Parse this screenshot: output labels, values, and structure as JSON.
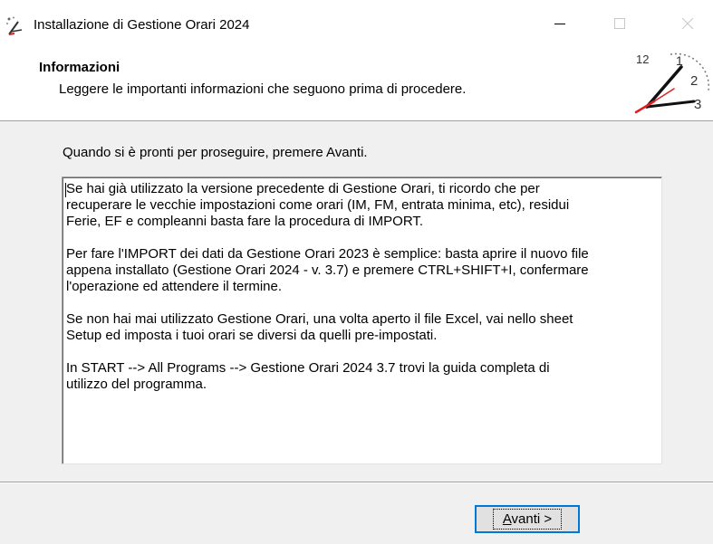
{
  "window": {
    "title": "Installazione di Gestione Orari 2024",
    "icons": {
      "app": "setup-wand-icon",
      "minimize": "minimize-icon",
      "maximize": "maximize-icon",
      "close": "close-icon"
    }
  },
  "header": {
    "title": "Informazioni",
    "subtitle": "Leggere le importanti informazioni che seguono prima di procedere.",
    "clock_icon": "clock-icon",
    "clock_numbers": {
      "twelve": "12",
      "one": "1",
      "two": "2",
      "three": "3"
    }
  },
  "body": {
    "prompt": "Quando si è pronti per proseguire, premere Avanti.",
    "info_text": "Se hai già utilizzato la versione precedente di Gestione Orari, ti ricordo che per\nrecuperare le vecchie impostazioni come orari (IM, FM, entrata minima, etc), residui\nFerie, EF e compleanni basta fare la procedura di IMPORT.\n\nPer fare l'IMPORT dei dati da Gestione Orari 2023 è semplice: basta aprire il nuovo file\nappena installato (Gestione Orari 2024 - v. 3.7) e premere CTRL+SHIFT+I, confermare\nl'operazione ed attendere il termine.\n\nSe non hai mai utilizzato Gestione Orari, una volta aperto il file Excel, vai nello sheet\nSetup ed imposta i tuoi orari se diversi da quelli pre-impostati.\n\nIn START --> All Programs --> Gestione Orari 2024 3.7 trovi la guida completa di\nutilizzo del programma."
  },
  "footer": {
    "next_mnemonic": "A",
    "next_rest": "vanti >"
  },
  "colors": {
    "accent_border": "#0078d7",
    "dialog_bg": "#f0f0f0",
    "header_bg": "#ffffff",
    "clock_hand_red": "#e02020"
  }
}
